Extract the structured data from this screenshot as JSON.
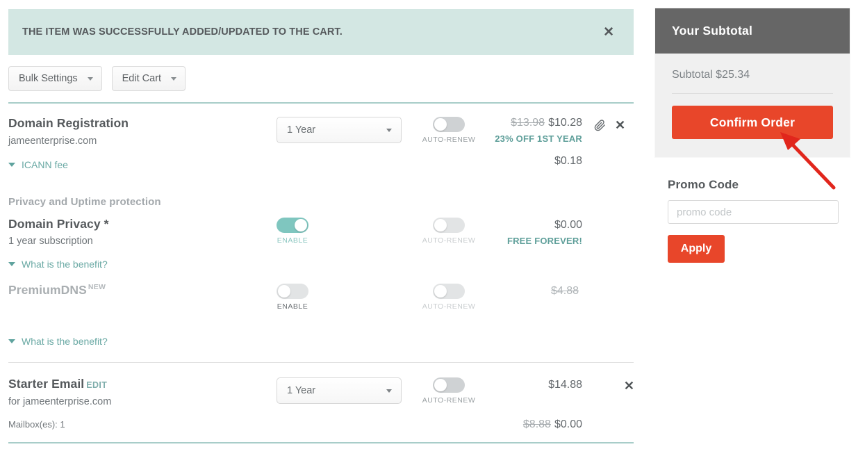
{
  "alert": {
    "message": "THE ITEM WAS SUCCESSFULLY ADDED/UPDATED TO THE CART.",
    "close_label": "✕",
    "background_color": "#d3e7e3"
  },
  "toolbar": {
    "bulk_settings_label": "Bulk Settings",
    "edit_cart_label": "Edit Cart"
  },
  "cart": {
    "domain_registration": {
      "title": "Domain Registration",
      "domain": "jameenterprise.com",
      "term": "1 Year",
      "auto_renew_label": "AUTO-RENEW",
      "price_original": "$13.98",
      "price_current": "$10.28",
      "promo_note": "23% OFF 1ST YEAR",
      "icann_disclosure": "ICANN fee",
      "icann_fee": "$0.18",
      "attach_icon": "paperclip-icon",
      "remove_icon": "close-icon"
    },
    "protection_group_label": "Privacy and Uptime protection",
    "domain_privacy": {
      "title": "Domain Privacy *",
      "subscription": "1 year subscription",
      "enable_label": "ENABLE",
      "enabled": true,
      "auto_renew_label": "AUTO-RENEW",
      "price": "$0.00",
      "promo_note": "FREE FOREVER!",
      "benefit_disclosure": "What is the benefit?"
    },
    "premium_dns": {
      "title": "PremiumDNS",
      "badge": "NEW",
      "enable_label": "ENABLE",
      "enabled": false,
      "auto_renew_label": "AUTO-RENEW",
      "price_struck": "$4.88",
      "benefit_disclosure": "What is the benefit?"
    },
    "starter_email": {
      "title": "Starter Email",
      "edit_label": "EDIT",
      "for_domain": "for jameenterprise.com",
      "term": "1 Year",
      "auto_renew_label": "AUTO-RENEW",
      "price": "$14.88",
      "mailboxes": "Mailbox(es): 1",
      "mailbox_price_original": "$8.88",
      "mailbox_price_current": "$0.00",
      "remove_icon": "close-icon"
    }
  },
  "sidebar": {
    "header_title": "Your Subtotal",
    "subtotal_line": "Subtotal $25.34",
    "confirm_button": "Confirm Order",
    "promo_title": "Promo Code",
    "promo_placeholder": "promo code",
    "promo_value": "",
    "apply_button": "Apply",
    "accent_color": "#e8462a",
    "header_color": "#666666"
  },
  "annotation": {
    "arrow_color": "#e1261c",
    "points_to": "Confirm Order"
  }
}
